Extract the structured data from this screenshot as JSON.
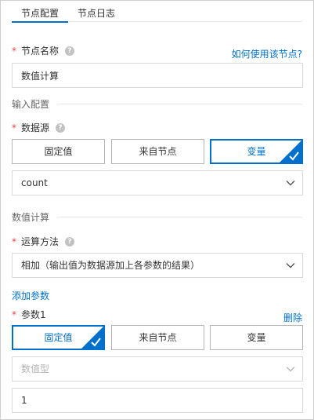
{
  "tabs": [
    {
      "label": "节点配置",
      "active": true
    },
    {
      "label": "节点日志",
      "active": false
    }
  ],
  "node_name": {
    "label": "节点名称",
    "help_link": "如何使用该节点?",
    "value": "数值计算"
  },
  "input_section": {
    "title": "输入配置",
    "data_source": {
      "label": "数据源",
      "options": [
        "固定值",
        "来自节点",
        "变量"
      ],
      "selected": "变量",
      "value": "count"
    }
  },
  "calc_section": {
    "title": "数值计算",
    "method": {
      "label": "运算方法",
      "value": "相加（输出值为数据源加上各参数的结果）"
    },
    "add_param_label": "添加参数",
    "param1": {
      "label": "参数1",
      "delete_label": "删除",
      "options": [
        "固定值",
        "来自节点",
        "变量"
      ],
      "selected": "固定值",
      "type_value": "数值型",
      "value": "1"
    }
  },
  "colors": {
    "accent": "#0070cc",
    "required": "#e44444",
    "border": "#d9d9d9"
  },
  "icons": {
    "help": "question-circle-icon",
    "chevron": "chevron-down-icon",
    "check": "check-corner-icon"
  }
}
